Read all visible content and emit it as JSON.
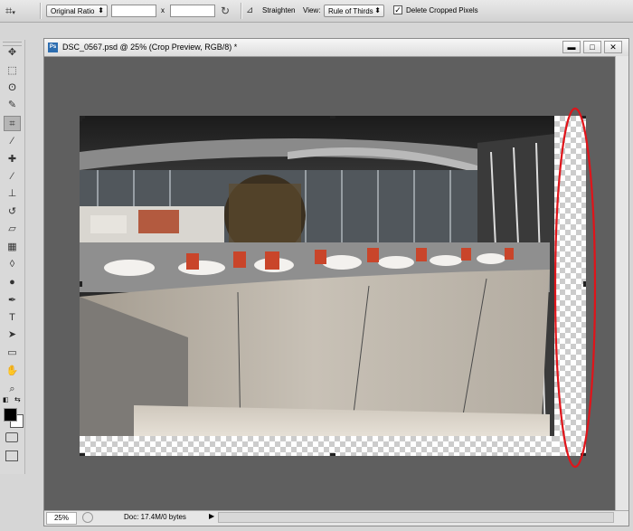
{
  "options_bar": {
    "ratio_preset": "Original Ratio",
    "ratio_width": "",
    "ratio_height": "",
    "by_sign": "x",
    "straighten_label": "Straighten",
    "view_label": "View:",
    "view_value": "Rule of Thirds",
    "delete_cropped_label": "Delete Cropped Pixels",
    "delete_cropped_checked": true,
    "check_glyph": "✓"
  },
  "document": {
    "title": "DSC_0567.psd @ 25% (Crop Preview, RGB/8) *",
    "app_badge": "Ps",
    "zoom": "25%",
    "doc_info": "Doc: 17.4M/0 bytes"
  },
  "tools": [
    {
      "name": "move-tool-icon",
      "glyph": "✥"
    },
    {
      "name": "marquee-tool-icon",
      "glyph": "⬚"
    },
    {
      "name": "lasso-tool-icon",
      "glyph": "ʘ"
    },
    {
      "name": "quick-select-tool-icon",
      "glyph": "✎"
    },
    {
      "name": "crop-tool-icon",
      "glyph": "⌗"
    },
    {
      "name": "eyedropper-tool-icon",
      "glyph": "⁄"
    },
    {
      "name": "healing-brush-tool-icon",
      "glyph": "✚"
    },
    {
      "name": "brush-tool-icon",
      "glyph": "⁄"
    },
    {
      "name": "clone-stamp-tool-icon",
      "glyph": "⊥"
    },
    {
      "name": "history-brush-tool-icon",
      "glyph": "↺"
    },
    {
      "name": "eraser-tool-icon",
      "glyph": "▱"
    },
    {
      "name": "gradient-tool-icon",
      "glyph": "▦"
    },
    {
      "name": "blur-tool-icon",
      "glyph": "◊"
    },
    {
      "name": "dodge-tool-icon",
      "glyph": "●"
    },
    {
      "name": "pen-tool-icon",
      "glyph": "✒"
    },
    {
      "name": "type-tool-icon",
      "glyph": "T"
    },
    {
      "name": "path-select-tool-icon",
      "glyph": "➤"
    },
    {
      "name": "shape-tool-icon",
      "glyph": "▭"
    },
    {
      "name": "hand-tool-icon",
      "glyph": "✋"
    },
    {
      "name": "zoom-tool-icon",
      "glyph": "⌕"
    }
  ],
  "window_controls": {
    "minimize": "▬",
    "maximize": "□",
    "close": "✕"
  },
  "colors": {
    "foreground": "#000000",
    "background": "#ffffff",
    "annotation": "#e0141a"
  }
}
